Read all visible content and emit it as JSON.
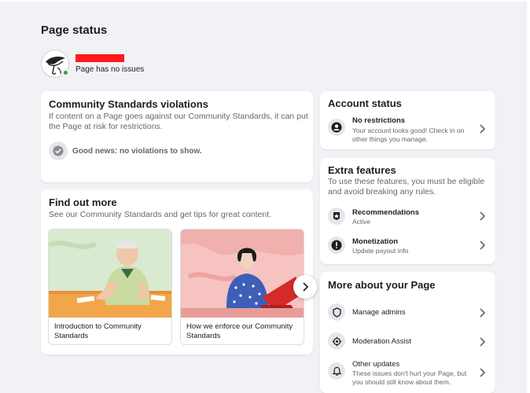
{
  "header": {
    "title": "Page status",
    "page_issue_text": "Page has no issues"
  },
  "community_standards": {
    "title": "Community Standards violations",
    "description": "If content on a Page goes against our Community Standards, it can put the Page at risk for restrictions.",
    "status": "Good news: no violations to show."
  },
  "find_out_more": {
    "title": "Find out more",
    "description": "See our Community Standards and get tips for great content.",
    "tiles": [
      {
        "label": "Introduction to Community Standards"
      },
      {
        "label": "How we enforce our Community Standards"
      }
    ]
  },
  "account_status": {
    "title": "Account status",
    "item_title": "No restrictions",
    "item_sub": "Your account looks good! Check in on other things you manage."
  },
  "extra_features": {
    "title": "Extra features",
    "description": "To use these features, you must be eligible and avoid breaking any rules.",
    "items": [
      {
        "title": "Recommendations",
        "sub": "Active",
        "icon": "recommendation-icon"
      },
      {
        "title": "Monetization",
        "sub": "Update payout info",
        "icon": "alert-icon"
      }
    ]
  },
  "more_about": {
    "title": "More about your Page",
    "items": [
      {
        "title": "Manage admins",
        "icon": "shield-icon"
      },
      {
        "title": "Moderation Assist",
        "icon": "gear-icon"
      },
      {
        "title": "Other updates",
        "sub": "These issues don't hurt your Page, but you should still know about them.",
        "icon": "bell-icon"
      }
    ]
  },
  "colors": {
    "background": "#f0f2f5",
    "card": "#ffffff",
    "online_dot": "#31a24c",
    "redaction": "#ff1a1a"
  }
}
